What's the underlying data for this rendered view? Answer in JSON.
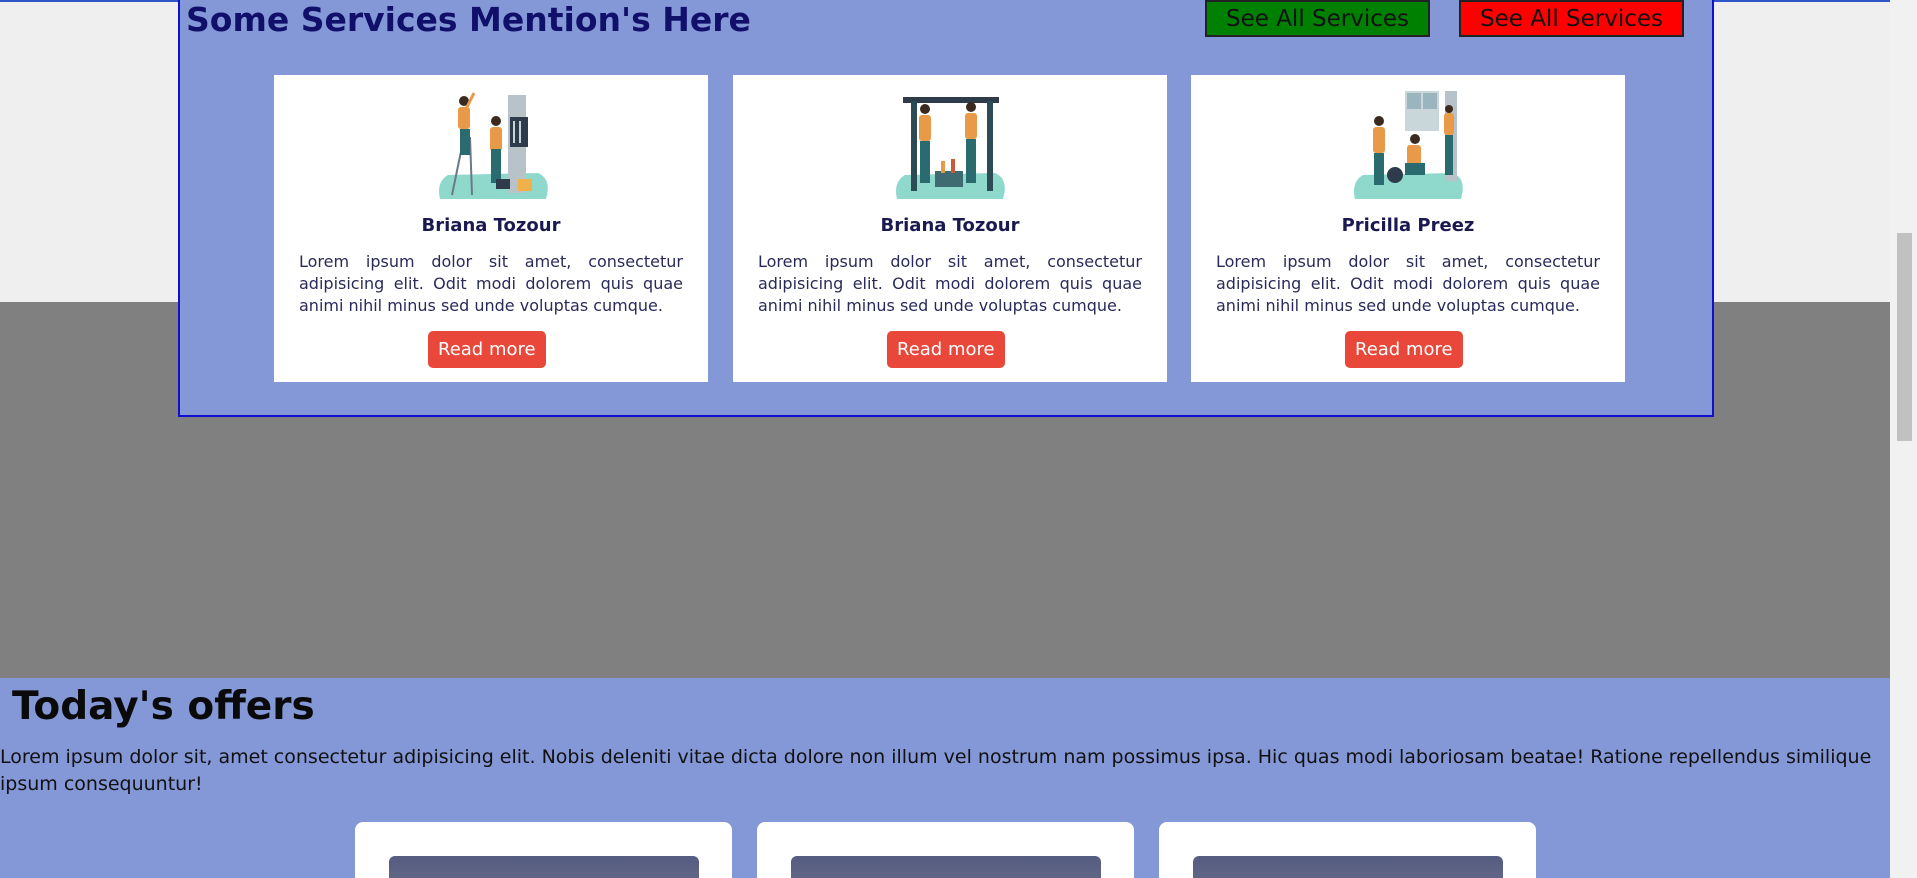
{
  "services": {
    "title": "Some Services Mention's Here",
    "button_green": "See All Services",
    "button_red": "See All Services",
    "cards": [
      {
        "name": "Briana Tozour",
        "text": "Lorem ipsum dolor sit amet, consectetur adipisicing elit. Odit modi dolorem quis quae animi nihil minus sed unde voluptas cumque.",
        "button": "Read more",
        "illustration": "electricians-illustration"
      },
      {
        "name": "Briana Tozour",
        "text": "Lorem ipsum dolor sit amet, consectetur adipisicing elit. Odit modi dolorem quis quae animi nihil minus sed unde voluptas cumque.",
        "button": "Read more",
        "illustration": "plumbers-illustration"
      },
      {
        "name": "Pricilla Preez",
        "text": "Lorem ipsum dolor sit amet, consectetur adipisicing elit. Odit modi dolorem quis quae animi nihil minus sed unde voluptas cumque.",
        "button": "Read more",
        "illustration": "repair-workers-illustration"
      }
    ]
  },
  "offers": {
    "title": "Today's offers",
    "text": "Lorem ipsum dolor sit, amet consectetur adipisicing elit. Nobis deleniti vitae dicta dolore non illum vel nostrum nam possimus ipsa. Hic quas modi laboriosam beatae! Ratione repellendus similique ipsum consequuntur!"
  },
  "colors": {
    "section_bg": "#8497d6",
    "accent_red": "#e8473a",
    "title_navy": "#10106a"
  }
}
